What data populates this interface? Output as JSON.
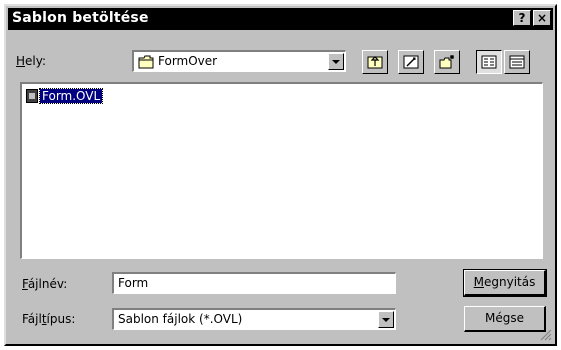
{
  "dialog": {
    "title": "Sablon betöltése",
    "help_label": "?",
    "close_label": "×"
  },
  "location": {
    "label_underlined": "H",
    "label_rest": "ely:",
    "value": "FormOver"
  },
  "toolbar": {
    "icons": [
      "up-one-level-icon",
      "desktop-icon",
      "new-folder-icon",
      "list-view-icon",
      "details-view-icon"
    ]
  },
  "files": [
    {
      "name": "Form.OVL"
    }
  ],
  "filename": {
    "label_underlined": "F",
    "label_rest": "ájlnév:",
    "value": "Form"
  },
  "filetype": {
    "label_pre": "Fájl",
    "label_underlined": "t",
    "label_post": "ípus:",
    "value": "Sablon fájlok (*.OVL)"
  },
  "buttons": {
    "open_underlined": "M",
    "open_rest": "egnyitás",
    "cancel": "Mégse"
  }
}
